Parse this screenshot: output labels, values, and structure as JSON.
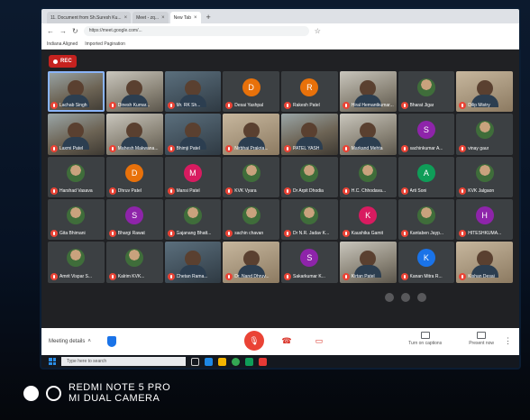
{
  "browser": {
    "tabs": [
      {
        "label": "11. Document from Sh.Suresh Ku...",
        "active": false
      },
      {
        "label": "Meet - zq...",
        "active": false
      },
      {
        "label": "New Tab",
        "active": true
      }
    ],
    "url": "https://meet.google.com/...",
    "bookmarks": [
      "Indiana Aligned",
      "Imported Pagination"
    ]
  },
  "meet": {
    "rec_label": "REC",
    "participants": [
      {
        "name": "Lachab Singh",
        "kind": "video"
      },
      {
        "name": "Dinesh Kumar...",
        "kind": "video"
      },
      {
        "name": "Mr. RK Sh...",
        "kind": "video"
      },
      {
        "name": "Desai Yashpal",
        "kind": "letter",
        "letter": "D",
        "color": "#e8710a"
      },
      {
        "name": "Rakesh Patel",
        "kind": "letter",
        "letter": "R",
        "color": "#e8710a"
      },
      {
        "name": "Hiral Hemantkumar...",
        "kind": "video"
      },
      {
        "name": "Bharat Jigar",
        "kind": "photo"
      },
      {
        "name": "Dilip Mistry",
        "kind": "video"
      },
      {
        "name": "Laxmi Patel",
        "kind": "video"
      },
      {
        "name": "Mahesh Makwana...",
        "kind": "video"
      },
      {
        "name": "Bhimji Patel",
        "kind": "video"
      },
      {
        "name": "Nirbhai Prakria...",
        "kind": "video"
      },
      {
        "name": "PATEL YASH",
        "kind": "video"
      },
      {
        "name": "Markand Mehta",
        "kind": "video"
      },
      {
        "name": "sachinkumar A...",
        "kind": "letter",
        "letter": "S",
        "color": "#8e24aa"
      },
      {
        "name": "vinay gaur",
        "kind": "photo"
      },
      {
        "name": "Harshad Vasava",
        "kind": "photo"
      },
      {
        "name": "Dhruv Patel",
        "kind": "letter",
        "letter": "D",
        "color": "#e8710a"
      },
      {
        "name": "Mansi Patel",
        "kind": "letter",
        "letter": "M",
        "color": "#d81b60"
      },
      {
        "name": "KVK Vyara",
        "kind": "photo"
      },
      {
        "name": "Dr Arpit Dhodia",
        "kind": "photo"
      },
      {
        "name": "H.C. Chhodava...",
        "kind": "photo"
      },
      {
        "name": "Arti Soni",
        "kind": "letter",
        "letter": "A",
        "color": "#0f9d58"
      },
      {
        "name": "KVK Jalgaon",
        "kind": "photo"
      },
      {
        "name": "Gita Bhimani",
        "kind": "photo"
      },
      {
        "name": "Bhargi Rawat",
        "kind": "letter",
        "letter": "S",
        "color": "#8e24aa"
      },
      {
        "name": "Gajanang Bhatt...",
        "kind": "photo"
      },
      {
        "name": "sachin chavan",
        "kind": "photo"
      },
      {
        "name": "Dr N.R. Jadav K...",
        "kind": "photo"
      },
      {
        "name": "Kaushika Gamit",
        "kind": "letter",
        "letter": "K",
        "color": "#d81b60"
      },
      {
        "name": "Kantaben Jayp...",
        "kind": "photo"
      },
      {
        "name": "HITESHKUMA...",
        "kind": "letter",
        "letter": "H",
        "color": "#8e24aa"
      },
      {
        "name": "Amrit Vispar S...",
        "kind": "photo"
      },
      {
        "name": "Kalrim KVK...",
        "kind": "photo"
      },
      {
        "name": "Chetan Rama...",
        "kind": "video"
      },
      {
        "name": "Dr. Nand Dhruv...",
        "kind": "video"
      },
      {
        "name": "Sakarkumar K...",
        "kind": "letter",
        "letter": "S",
        "color": "#8e24aa"
      },
      {
        "name": "Kirtan Patel",
        "kind": "video"
      },
      {
        "name": "Kanan Mitra R...",
        "kind": "letter",
        "letter": "K",
        "color": "#1a73e8"
      },
      {
        "name": "Kishan Desai",
        "kind": "video"
      }
    ]
  },
  "bottombar": {
    "meeting_details": "Meeting details",
    "captions_label": "Turn on captions",
    "present_label": "Present now"
  },
  "taskbar": {
    "search_placeholder": "Type here to search"
  },
  "watermark": {
    "line1": "REDMI NOTE 5 PRO",
    "line2": "MI DUAL CAMERA"
  }
}
